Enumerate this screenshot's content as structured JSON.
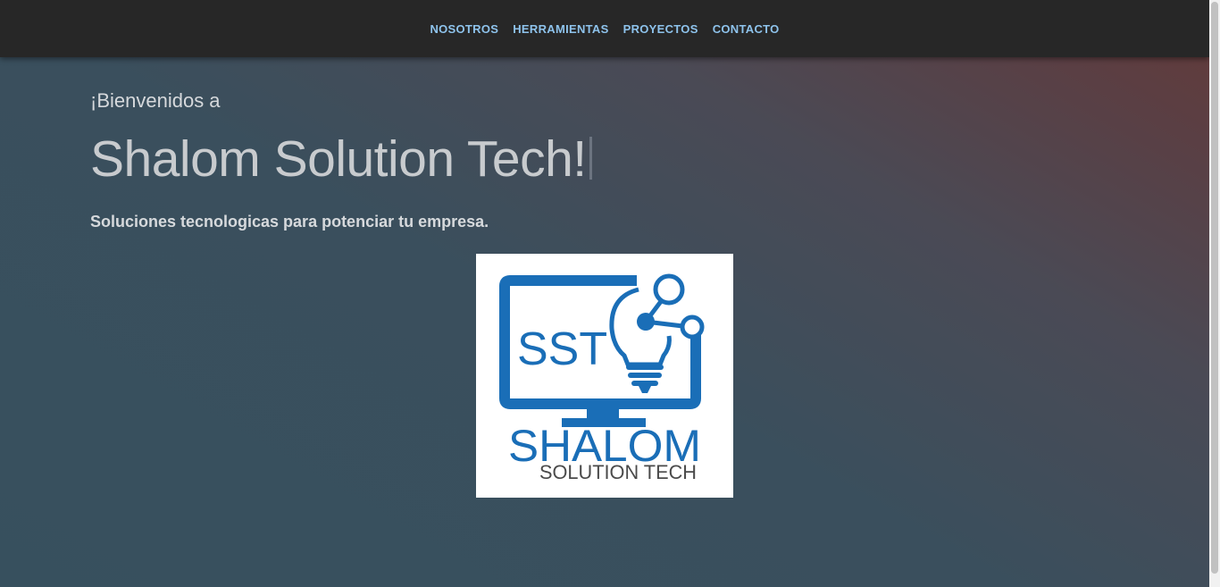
{
  "nav": {
    "items": [
      {
        "label": "NOSOTROS"
      },
      {
        "label": "HERRAMIENTAS"
      },
      {
        "label": "PROYECTOS"
      },
      {
        "label": "CONTACTO"
      }
    ]
  },
  "hero": {
    "welcome": "¡Bienvenidos a",
    "title": "Shalom Solution Tech!",
    "subtitle": "Soluciones tecnologicas para potenciar tu empresa."
  },
  "logo": {
    "monogram": "SST",
    "name": "SHALOM",
    "tagline": "SOLUTION TECH"
  },
  "colors": {
    "navbar_bg": "#272727",
    "nav_link": "#8ec3ec",
    "logo_blue": "#1a6eb7",
    "logo_gray": "#4a4a4a"
  }
}
